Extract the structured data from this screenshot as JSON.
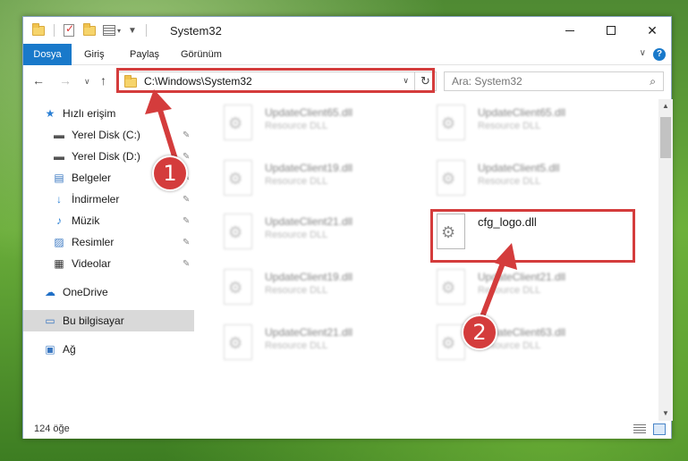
{
  "title_bar": {
    "title": "System32"
  },
  "ribbon": {
    "tabs": [
      "Dosya",
      "Giriş",
      "Paylaş",
      "Görünüm"
    ],
    "help_icon": "?"
  },
  "navigation": {
    "address": "C:\\Windows\\System32",
    "search_placeholder": "Ara: System32"
  },
  "sidebar": {
    "items": [
      {
        "label": "Hızlı erişim",
        "icon": "star-icon"
      },
      {
        "label": "Yerel Disk (C:)",
        "icon": "drive-icon"
      },
      {
        "label": "Yerel Disk (D:)",
        "icon": "drive-icon"
      },
      {
        "label": "Belgeler",
        "icon": "document-icon"
      },
      {
        "label": "İndirmeler",
        "icon": "download-icon"
      },
      {
        "label": "Müzik",
        "icon": "music-icon"
      },
      {
        "label": "Resimler",
        "icon": "image-icon"
      },
      {
        "label": "Videolar",
        "icon": "video-icon"
      },
      {
        "label": "OneDrive",
        "icon": "cloud-icon"
      },
      {
        "label": "Bu bilgisayar",
        "icon": "computer-icon"
      },
      {
        "label": "Ağ",
        "icon": "network-icon"
      }
    ]
  },
  "files": [
    {
      "name": "UpdateClient65.dll",
      "type": "Resource DLL"
    },
    {
      "name": "UpdateClient65.dll",
      "type": "Resource DLL"
    },
    {
      "name": "UpdateClient19.dll",
      "type": "Resource DLL"
    },
    {
      "name": "UpdateClient5.dll",
      "type": "Resource DLL"
    },
    {
      "name": "UpdateClient21.dll",
      "type": "Resource DLL"
    },
    {
      "name": "cfg_logo.dll",
      "type": ""
    },
    {
      "name": "UpdateClient19.dll",
      "type": "Resource DLL"
    },
    {
      "name": "UpdateClient21.dll",
      "type": "Resource DLL"
    },
    {
      "name": "UpdateClient21.dll",
      "type": "Resource DLL"
    },
    {
      "name": "UpdateClient63.dll",
      "type": "Resource DLL"
    }
  ],
  "status": {
    "item_count": "124 öğe"
  },
  "annotations": {
    "step1": "1",
    "step2": "2",
    "highlight_color": "#d43c3c"
  }
}
